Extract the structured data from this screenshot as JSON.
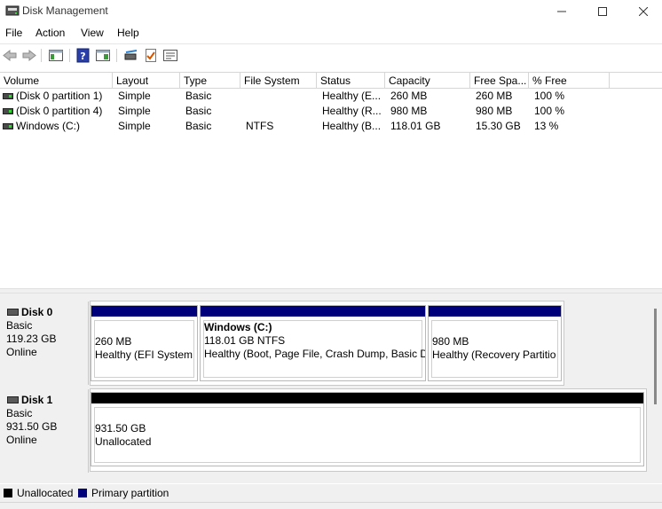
{
  "window": {
    "title": "Disk Management"
  },
  "menu": [
    "File",
    "Action",
    "View",
    "Help"
  ],
  "toolbar": {
    "buttons": [
      "back-icon",
      "forward-icon",
      "console-tree-icon",
      "help-icon",
      "properties-icon",
      "checklist-icon",
      "settings-list-icon"
    ]
  },
  "volume_table": {
    "columns": [
      "Volume",
      "Layout",
      "Type",
      "File System",
      "Status",
      "Capacity",
      "Free Spa...",
      "% Free"
    ],
    "rows": [
      {
        "volume": "(Disk 0 partition 1)",
        "layout": "Simple",
        "type": "Basic",
        "fs": "",
        "status": "Healthy (E...",
        "capacity": "260 MB",
        "free": "260 MB",
        "pct": "100 %"
      },
      {
        "volume": "(Disk 0 partition 4)",
        "layout": "Simple",
        "type": "Basic",
        "fs": "",
        "status": "Healthy (R...",
        "capacity": "980 MB",
        "free": "980 MB",
        "pct": "100 %"
      },
      {
        "volume": "Windows (C:)",
        "layout": "Simple",
        "type": "Basic",
        "fs": "NTFS",
        "status": "Healthy (B...",
        "capacity": "118.01 GB",
        "free": "15.30 GB",
        "pct": "13 %"
      }
    ]
  },
  "disks": [
    {
      "name": "Disk 0",
      "type": "Basic",
      "size": "119.23 GB",
      "state": "Online",
      "partitions": [
        {
          "title": "",
          "line1": "260 MB",
          "line2": "Healthy (EFI System"
        },
        {
          "title": "Windows  (C:)",
          "line1": "118.01 GB NTFS",
          "line2": "Healthy (Boot, Page File, Crash Dump, Basic D"
        },
        {
          "title": "",
          "line1": "980 MB",
          "line2": "Healthy (Recovery Partitio"
        }
      ]
    },
    {
      "name": "Disk 1",
      "type": "Basic",
      "size": "931.50 GB",
      "state": "Online",
      "partitions": [
        {
          "title": "",
          "line1": "931.50 GB",
          "line2": "Unallocated"
        }
      ]
    }
  ],
  "legend": [
    {
      "label": "Unallocated",
      "color": "#000000"
    },
    {
      "label": "Primary partition",
      "color": "#00007b"
    }
  ],
  "colors": {
    "primary_partition": "#00007b",
    "unallocated": "#000000"
  }
}
